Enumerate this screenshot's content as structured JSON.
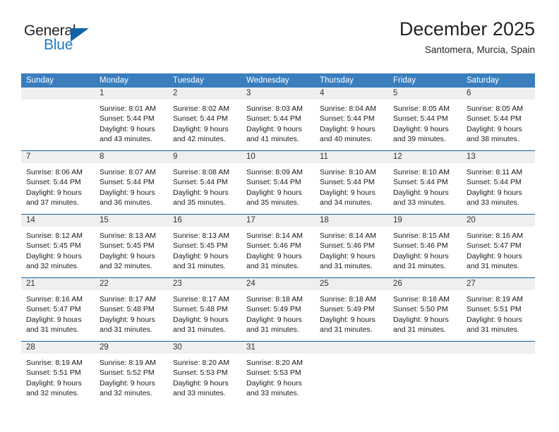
{
  "brand": {
    "name_top": "General",
    "name_bottom": "Blue",
    "triangle_icon": "triangle-icon",
    "accent_color": "#1163a8"
  },
  "header": {
    "title": "December 2025",
    "subtitle": "Santomera, Murcia, Spain"
  },
  "theme": {
    "header_bar_color": "#3a7ebe",
    "row_separator_color": "#1263a4",
    "daynum_band_color": "#efefef"
  },
  "weekdays": [
    "Sunday",
    "Monday",
    "Tuesday",
    "Wednesday",
    "Thursday",
    "Friday",
    "Saturday"
  ],
  "weeks": [
    [
      {
        "day": "",
        "lines": []
      },
      {
        "day": "1",
        "lines": [
          "Sunrise: 8:01 AM",
          "Sunset: 5:44 PM",
          "Daylight: 9 hours",
          "and 43 minutes."
        ]
      },
      {
        "day": "2",
        "lines": [
          "Sunrise: 8:02 AM",
          "Sunset: 5:44 PM",
          "Daylight: 9 hours",
          "and 42 minutes."
        ]
      },
      {
        "day": "3",
        "lines": [
          "Sunrise: 8:03 AM",
          "Sunset: 5:44 PM",
          "Daylight: 9 hours",
          "and 41 minutes."
        ]
      },
      {
        "day": "4",
        "lines": [
          "Sunrise: 8:04 AM",
          "Sunset: 5:44 PM",
          "Daylight: 9 hours",
          "and 40 minutes."
        ]
      },
      {
        "day": "5",
        "lines": [
          "Sunrise: 8:05 AM",
          "Sunset: 5:44 PM",
          "Daylight: 9 hours",
          "and 39 minutes."
        ]
      },
      {
        "day": "6",
        "lines": [
          "Sunrise: 8:05 AM",
          "Sunset: 5:44 PM",
          "Daylight: 9 hours",
          "and 38 minutes."
        ]
      }
    ],
    [
      {
        "day": "7",
        "lines": [
          "Sunrise: 8:06 AM",
          "Sunset: 5:44 PM",
          "Daylight: 9 hours",
          "and 37 minutes."
        ]
      },
      {
        "day": "8",
        "lines": [
          "Sunrise: 8:07 AM",
          "Sunset: 5:44 PM",
          "Daylight: 9 hours",
          "and 36 minutes."
        ]
      },
      {
        "day": "9",
        "lines": [
          "Sunrise: 8:08 AM",
          "Sunset: 5:44 PM",
          "Daylight: 9 hours",
          "and 35 minutes."
        ]
      },
      {
        "day": "10",
        "lines": [
          "Sunrise: 8:09 AM",
          "Sunset: 5:44 PM",
          "Daylight: 9 hours",
          "and 35 minutes."
        ]
      },
      {
        "day": "11",
        "lines": [
          "Sunrise: 8:10 AM",
          "Sunset: 5:44 PM",
          "Daylight: 9 hours",
          "and 34 minutes."
        ]
      },
      {
        "day": "12",
        "lines": [
          "Sunrise: 8:10 AM",
          "Sunset: 5:44 PM",
          "Daylight: 9 hours",
          "and 33 minutes."
        ]
      },
      {
        "day": "13",
        "lines": [
          "Sunrise: 8:11 AM",
          "Sunset: 5:44 PM",
          "Daylight: 9 hours",
          "and 33 minutes."
        ]
      }
    ],
    [
      {
        "day": "14",
        "lines": [
          "Sunrise: 8:12 AM",
          "Sunset: 5:45 PM",
          "Daylight: 9 hours",
          "and 32 minutes."
        ]
      },
      {
        "day": "15",
        "lines": [
          "Sunrise: 8:13 AM",
          "Sunset: 5:45 PM",
          "Daylight: 9 hours",
          "and 32 minutes."
        ]
      },
      {
        "day": "16",
        "lines": [
          "Sunrise: 8:13 AM",
          "Sunset: 5:45 PM",
          "Daylight: 9 hours",
          "and 31 minutes."
        ]
      },
      {
        "day": "17",
        "lines": [
          "Sunrise: 8:14 AM",
          "Sunset: 5:46 PM",
          "Daylight: 9 hours",
          "and 31 minutes."
        ]
      },
      {
        "day": "18",
        "lines": [
          "Sunrise: 8:14 AM",
          "Sunset: 5:46 PM",
          "Daylight: 9 hours",
          "and 31 minutes."
        ]
      },
      {
        "day": "19",
        "lines": [
          "Sunrise: 8:15 AM",
          "Sunset: 5:46 PM",
          "Daylight: 9 hours",
          "and 31 minutes."
        ]
      },
      {
        "day": "20",
        "lines": [
          "Sunrise: 8:16 AM",
          "Sunset: 5:47 PM",
          "Daylight: 9 hours",
          "and 31 minutes."
        ]
      }
    ],
    [
      {
        "day": "21",
        "lines": [
          "Sunrise: 8:16 AM",
          "Sunset: 5:47 PM",
          "Daylight: 9 hours",
          "and 31 minutes."
        ]
      },
      {
        "day": "22",
        "lines": [
          "Sunrise: 8:17 AM",
          "Sunset: 5:48 PM",
          "Daylight: 9 hours",
          "and 31 minutes."
        ]
      },
      {
        "day": "23",
        "lines": [
          "Sunrise: 8:17 AM",
          "Sunset: 5:48 PM",
          "Daylight: 9 hours",
          "and 31 minutes."
        ]
      },
      {
        "day": "24",
        "lines": [
          "Sunrise: 8:18 AM",
          "Sunset: 5:49 PM",
          "Daylight: 9 hours",
          "and 31 minutes."
        ]
      },
      {
        "day": "25",
        "lines": [
          "Sunrise: 8:18 AM",
          "Sunset: 5:49 PM",
          "Daylight: 9 hours",
          "and 31 minutes."
        ]
      },
      {
        "day": "26",
        "lines": [
          "Sunrise: 8:18 AM",
          "Sunset: 5:50 PM",
          "Daylight: 9 hours",
          "and 31 minutes."
        ]
      },
      {
        "day": "27",
        "lines": [
          "Sunrise: 8:19 AM",
          "Sunset: 5:51 PM",
          "Daylight: 9 hours",
          "and 31 minutes."
        ]
      }
    ],
    [
      {
        "day": "28",
        "lines": [
          "Sunrise: 8:19 AM",
          "Sunset: 5:51 PM",
          "Daylight: 9 hours",
          "and 32 minutes."
        ]
      },
      {
        "day": "29",
        "lines": [
          "Sunrise: 8:19 AM",
          "Sunset: 5:52 PM",
          "Daylight: 9 hours",
          "and 32 minutes."
        ]
      },
      {
        "day": "30",
        "lines": [
          "Sunrise: 8:20 AM",
          "Sunset: 5:53 PM",
          "Daylight: 9 hours",
          "and 33 minutes."
        ]
      },
      {
        "day": "31",
        "lines": [
          "Sunrise: 8:20 AM",
          "Sunset: 5:53 PM",
          "Daylight: 9 hours",
          "and 33 minutes."
        ]
      },
      {
        "day": "",
        "lines": []
      },
      {
        "day": "",
        "lines": []
      },
      {
        "day": "",
        "lines": []
      }
    ]
  ]
}
